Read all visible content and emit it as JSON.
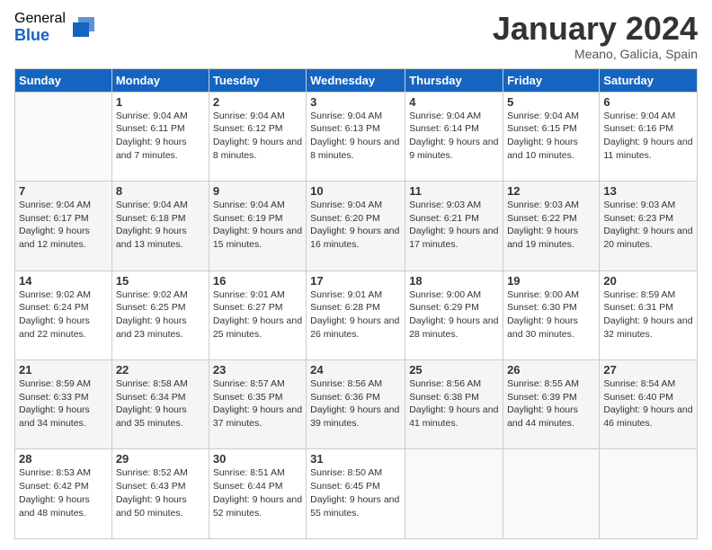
{
  "logo": {
    "general": "General",
    "blue": "Blue"
  },
  "header": {
    "month": "January 2024",
    "location": "Meano, Galicia, Spain"
  },
  "weekdays": [
    "Sunday",
    "Monday",
    "Tuesday",
    "Wednesday",
    "Thursday",
    "Friday",
    "Saturday"
  ],
  "weeks": [
    [
      {
        "day": "",
        "sunrise": "",
        "sunset": "",
        "daylight": ""
      },
      {
        "day": "1",
        "sunrise": "Sunrise: 9:04 AM",
        "sunset": "Sunset: 6:11 PM",
        "daylight": "Daylight: 9 hours and 7 minutes."
      },
      {
        "day": "2",
        "sunrise": "Sunrise: 9:04 AM",
        "sunset": "Sunset: 6:12 PM",
        "daylight": "Daylight: 9 hours and 8 minutes."
      },
      {
        "day": "3",
        "sunrise": "Sunrise: 9:04 AM",
        "sunset": "Sunset: 6:13 PM",
        "daylight": "Daylight: 9 hours and 8 minutes."
      },
      {
        "day": "4",
        "sunrise": "Sunrise: 9:04 AM",
        "sunset": "Sunset: 6:14 PM",
        "daylight": "Daylight: 9 hours and 9 minutes."
      },
      {
        "day": "5",
        "sunrise": "Sunrise: 9:04 AM",
        "sunset": "Sunset: 6:15 PM",
        "daylight": "Daylight: 9 hours and 10 minutes."
      },
      {
        "day": "6",
        "sunrise": "Sunrise: 9:04 AM",
        "sunset": "Sunset: 6:16 PM",
        "daylight": "Daylight: 9 hours and 11 minutes."
      }
    ],
    [
      {
        "day": "7",
        "sunrise": "Sunrise: 9:04 AM",
        "sunset": "Sunset: 6:17 PM",
        "daylight": "Daylight: 9 hours and 12 minutes."
      },
      {
        "day": "8",
        "sunrise": "Sunrise: 9:04 AM",
        "sunset": "Sunset: 6:18 PM",
        "daylight": "Daylight: 9 hours and 13 minutes."
      },
      {
        "day": "9",
        "sunrise": "Sunrise: 9:04 AM",
        "sunset": "Sunset: 6:19 PM",
        "daylight": "Daylight: 9 hours and 15 minutes."
      },
      {
        "day": "10",
        "sunrise": "Sunrise: 9:04 AM",
        "sunset": "Sunset: 6:20 PM",
        "daylight": "Daylight: 9 hours and 16 minutes."
      },
      {
        "day": "11",
        "sunrise": "Sunrise: 9:03 AM",
        "sunset": "Sunset: 6:21 PM",
        "daylight": "Daylight: 9 hours and 17 minutes."
      },
      {
        "day": "12",
        "sunrise": "Sunrise: 9:03 AM",
        "sunset": "Sunset: 6:22 PM",
        "daylight": "Daylight: 9 hours and 19 minutes."
      },
      {
        "day": "13",
        "sunrise": "Sunrise: 9:03 AM",
        "sunset": "Sunset: 6:23 PM",
        "daylight": "Daylight: 9 hours and 20 minutes."
      }
    ],
    [
      {
        "day": "14",
        "sunrise": "Sunrise: 9:02 AM",
        "sunset": "Sunset: 6:24 PM",
        "daylight": "Daylight: 9 hours and 22 minutes."
      },
      {
        "day": "15",
        "sunrise": "Sunrise: 9:02 AM",
        "sunset": "Sunset: 6:25 PM",
        "daylight": "Daylight: 9 hours and 23 minutes."
      },
      {
        "day": "16",
        "sunrise": "Sunrise: 9:01 AM",
        "sunset": "Sunset: 6:27 PM",
        "daylight": "Daylight: 9 hours and 25 minutes."
      },
      {
        "day": "17",
        "sunrise": "Sunrise: 9:01 AM",
        "sunset": "Sunset: 6:28 PM",
        "daylight": "Daylight: 9 hours and 26 minutes."
      },
      {
        "day": "18",
        "sunrise": "Sunrise: 9:00 AM",
        "sunset": "Sunset: 6:29 PM",
        "daylight": "Daylight: 9 hours and 28 minutes."
      },
      {
        "day": "19",
        "sunrise": "Sunrise: 9:00 AM",
        "sunset": "Sunset: 6:30 PM",
        "daylight": "Daylight: 9 hours and 30 minutes."
      },
      {
        "day": "20",
        "sunrise": "Sunrise: 8:59 AM",
        "sunset": "Sunset: 6:31 PM",
        "daylight": "Daylight: 9 hours and 32 minutes."
      }
    ],
    [
      {
        "day": "21",
        "sunrise": "Sunrise: 8:59 AM",
        "sunset": "Sunset: 6:33 PM",
        "daylight": "Daylight: 9 hours and 34 minutes."
      },
      {
        "day": "22",
        "sunrise": "Sunrise: 8:58 AM",
        "sunset": "Sunset: 6:34 PM",
        "daylight": "Daylight: 9 hours and 35 minutes."
      },
      {
        "day": "23",
        "sunrise": "Sunrise: 8:57 AM",
        "sunset": "Sunset: 6:35 PM",
        "daylight": "Daylight: 9 hours and 37 minutes."
      },
      {
        "day": "24",
        "sunrise": "Sunrise: 8:56 AM",
        "sunset": "Sunset: 6:36 PM",
        "daylight": "Daylight: 9 hours and 39 minutes."
      },
      {
        "day": "25",
        "sunrise": "Sunrise: 8:56 AM",
        "sunset": "Sunset: 6:38 PM",
        "daylight": "Daylight: 9 hours and 41 minutes."
      },
      {
        "day": "26",
        "sunrise": "Sunrise: 8:55 AM",
        "sunset": "Sunset: 6:39 PM",
        "daylight": "Daylight: 9 hours and 44 minutes."
      },
      {
        "day": "27",
        "sunrise": "Sunrise: 8:54 AM",
        "sunset": "Sunset: 6:40 PM",
        "daylight": "Daylight: 9 hours and 46 minutes."
      }
    ],
    [
      {
        "day": "28",
        "sunrise": "Sunrise: 8:53 AM",
        "sunset": "Sunset: 6:42 PM",
        "daylight": "Daylight: 9 hours and 48 minutes."
      },
      {
        "day": "29",
        "sunrise": "Sunrise: 8:52 AM",
        "sunset": "Sunset: 6:43 PM",
        "daylight": "Daylight: 9 hours and 50 minutes."
      },
      {
        "day": "30",
        "sunrise": "Sunrise: 8:51 AM",
        "sunset": "Sunset: 6:44 PM",
        "daylight": "Daylight: 9 hours and 52 minutes."
      },
      {
        "day": "31",
        "sunrise": "Sunrise: 8:50 AM",
        "sunset": "Sunset: 6:45 PM",
        "daylight": "Daylight: 9 hours and 55 minutes."
      },
      {
        "day": "",
        "sunrise": "",
        "sunset": "",
        "daylight": ""
      },
      {
        "day": "",
        "sunrise": "",
        "sunset": "",
        "daylight": ""
      },
      {
        "day": "",
        "sunrise": "",
        "sunset": "",
        "daylight": ""
      }
    ]
  ]
}
